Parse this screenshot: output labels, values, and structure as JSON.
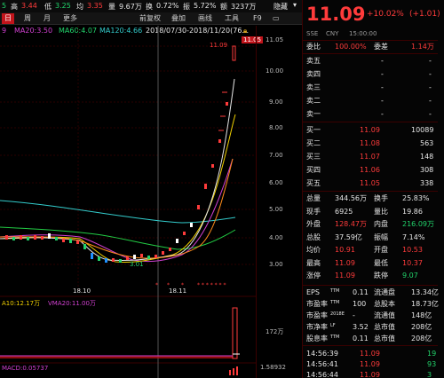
{
  "info_bar": {
    "open_val": "5",
    "high_label": "高",
    "high_val": "3.44",
    "low_label": "低",
    "low_val": "3.25",
    "avg_label": "均",
    "avg_val": "3.35",
    "volume_label": "量",
    "volume_val": "9.67万",
    "turnover_label": "换",
    "turnover_val": "0.72%",
    "amplitude_label": "振",
    "amplitude_val": "5.72%",
    "amount_label": "额",
    "amount_val": "3237万",
    "hide_label": "隐藏"
  },
  "toolbar": {
    "tabs": [
      "日",
      "周",
      "月",
      "更多"
    ],
    "buttons": [
      "前复权",
      "叠加",
      "画线",
      "工具",
      "F9"
    ]
  },
  "ma_legend": {
    "ma_start": "9",
    "ma20": "MA20:3.50",
    "ma60": "MA60:4.07",
    "ma120": "MA120:4.66",
    "date_range": "2018/07/30-2018/11/20(76...",
    "price_box": "11.05"
  },
  "chart_annotations": {
    "high_marker": "11.09",
    "low_marker": "3.01",
    "date1": "18.10",
    "date2": "18.11"
  },
  "price_axis": [
    "11.05",
    "10.00",
    "9.00",
    "8.00",
    "7.00",
    "6.00",
    "5.00",
    "4.00",
    "3.00"
  ],
  "volume": {
    "vma10": "A10:12.17万",
    "vma20": "VMA20:11.00万",
    "axis_label": "172万"
  },
  "macd": {
    "label": "MACD:0.05737",
    "axis_label": "1.58932"
  },
  "quote": {
    "price": "11.09",
    "change_pct": "+10.02%",
    "change_abs": "(+1.01)",
    "market": "SSE",
    "currency": "CNY",
    "time": "15:00:00",
    "weibi_label": "委比",
    "weibi_val": "100.00%",
    "weicha_label": "委差",
    "weicha_val": "1.14万"
  },
  "order_book": {
    "asks": [
      {
        "label": "卖五",
        "price": "-",
        "vol": "-"
      },
      {
        "label": "卖四",
        "price": "-",
        "vol": "-"
      },
      {
        "label": "卖三",
        "price": "-",
        "vol": "-"
      },
      {
        "label": "卖二",
        "price": "-",
        "vol": "-"
      },
      {
        "label": "卖一",
        "price": "-",
        "vol": "-"
      }
    ],
    "bids": [
      {
        "label": "买一",
        "price": "11.09",
        "vol": "10089"
      },
      {
        "label": "买二",
        "price": "11.08",
        "vol": "563"
      },
      {
        "label": "买三",
        "price": "11.07",
        "vol": "148"
      },
      {
        "label": "买四",
        "price": "11.06",
        "vol": "308"
      },
      {
        "label": "买五",
        "price": "11.05",
        "vol": "338"
      }
    ]
  },
  "stats": [
    {
      "l1": "总量",
      "v1": "344.56万",
      "l2": "换手",
      "v2": "25.83%",
      "c1": "white",
      "c2": "white"
    },
    {
      "l1": "现手",
      "v1": "6925",
      "l2": "量比",
      "v2": "19.86",
      "c1": "white",
      "c2": "white"
    },
    {
      "l1": "外盘",
      "v1": "128.47万",
      "l2": "内盘",
      "v2": "216.09万",
      "c1": "red",
      "c2": "green"
    },
    {
      "l1": "总股",
      "v1": "37.59亿",
      "l2": "振幅",
      "v2": "7.14%",
      "c1": "white",
      "c2": "white"
    },
    {
      "l1": "均价",
      "v1": "10.91",
      "l2": "开盘",
      "v2": "10.53",
      "c1": "red",
      "c2": "red"
    },
    {
      "l1": "最高",
      "v1": "11.09",
      "l2": "最低",
      "v2": "10.37",
      "c1": "red",
      "c2": "red"
    },
    {
      "l1": "涨停",
      "v1": "11.09",
      "l2": "跌停",
      "v2": "9.07",
      "c1": "red",
      "c2": "green"
    }
  ],
  "fundamentals": [
    {
      "l1": "EPS",
      "s1": "TTM",
      "v1": "0.11",
      "l2": "流通盘",
      "v2": "13.34亿"
    },
    {
      "l1": "市盈率",
      "s1": "TTM",
      "v1": "100",
      "l2": "总股本",
      "v2": "18.73亿"
    },
    {
      "l1": "市盈率",
      "s1": "2018E",
      "v1": "-",
      "l2": "流通值",
      "v2": "148亿"
    },
    {
      "l1": "市净率",
      "s1": "LF",
      "v1": "3.52",
      "l2": "总市值",
      "v2": "208亿"
    },
    {
      "l1": "股息率",
      "s1": "TTM",
      "v1": "0.11",
      "l2": "总市值",
      "v2": "208亿"
    }
  ],
  "trades": [
    {
      "time": "14:56:39",
      "price": "11.09",
      "vol": "19"
    },
    {
      "time": "14:56:41",
      "price": "11.09",
      "vol": "93"
    },
    {
      "time": "14:56:44",
      "price": "11.09",
      "vol": "3"
    }
  ],
  "colors": {
    "up": "#ff3b3b",
    "down": "#22d36b",
    "accent": "#c2141b",
    "ma5": "#e6e6e6",
    "ma10": "#f0d000",
    "ma20": "#d040d0",
    "ma60": "#22cc44",
    "ma120": "#33cccc"
  }
}
